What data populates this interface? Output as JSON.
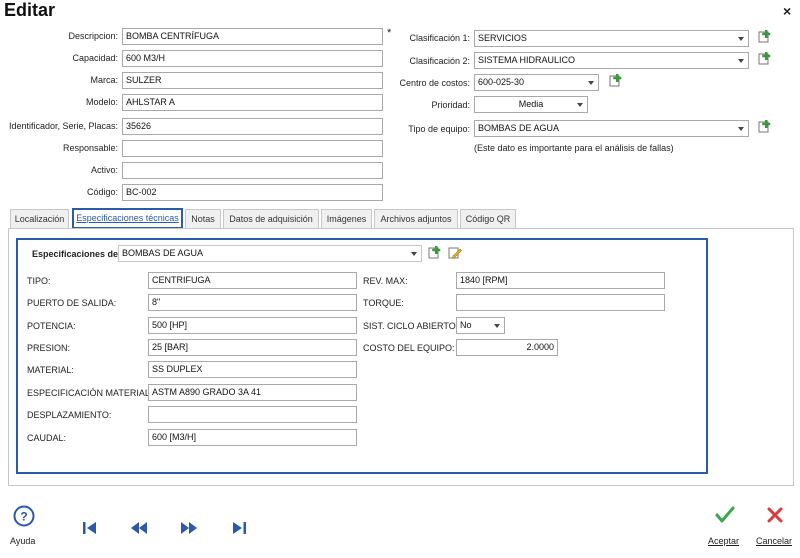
{
  "window": {
    "title": "Editar",
    "close_label": "×"
  },
  "form": {
    "descripcion": {
      "label": "Descripcion:",
      "value": "BOMBA CENTRÍFUGA",
      "required_mark": "*"
    },
    "capacidad": {
      "label": "Capacidad:",
      "value": "600 M3/H"
    },
    "marca": {
      "label": "Marca:",
      "value": "SULZER"
    },
    "modelo": {
      "label": "Modelo:",
      "value": "AHLSTAR A"
    },
    "identificador": {
      "label": "Identificador, Serie, Placas:",
      "value": "35626"
    },
    "responsable": {
      "label": "Responsable:",
      "value": ""
    },
    "activo": {
      "label": "Activo:",
      "value": ""
    },
    "codigo": {
      "label": "Código:",
      "value": "BC-002"
    }
  },
  "classification": {
    "clasificacion1": {
      "label": "Clasificación 1:",
      "value": "SERVICIOS"
    },
    "clasificacion2": {
      "label": "Clasificación 2:",
      "value": "SISTEMA HIDRAULICO"
    },
    "centro_costos": {
      "label": "Centro de costos:",
      "value": "600-025-30"
    },
    "prioridad": {
      "label": "Prioridad:",
      "value": "Media"
    },
    "tipo_equipo": {
      "label": "Tipo de equipo:",
      "value": "BOMBAS DE AGUA"
    },
    "note": "(Este dato es importante para el análisis de fallas)"
  },
  "tabs": [
    {
      "label": "Localización"
    },
    {
      "label": "Especificaciones técnicas"
    },
    {
      "label": "Notas"
    },
    {
      "label": "Datos de adquisición"
    },
    {
      "label": "Imágenes"
    },
    {
      "label": "Archivos adjuntos"
    },
    {
      "label": "Código QR"
    }
  ],
  "active_tab": "Especificaciones técnicas",
  "specs": {
    "header_label": "Especificaciones de:",
    "header_value": "BOMBAS DE AGUA",
    "left": [
      {
        "label": "TIPO:",
        "value": "CENTRIFUGA"
      },
      {
        "label": "PUERTO DE SALIDA:",
        "value": "8\""
      },
      {
        "label": "POTENCIA:",
        "value": "500 [HP]"
      },
      {
        "label": "PRESION:",
        "value": "25 [BAR]"
      },
      {
        "label": "MATERIAL:",
        "value": "SS DUPLEX"
      },
      {
        "label": "ESPECIFICACIÓN MATERIAL:",
        "value": "ASTM A890 GRADO 3A 41"
      },
      {
        "label": "DESPLAZAMIENTO:",
        "value": ""
      },
      {
        "label": "CAUDAL:",
        "value": "600 [M3/H]"
      }
    ],
    "right": [
      {
        "label": "REV. MAX:",
        "value": "1840 [RPM]"
      },
      {
        "label": "TORQUE:",
        "value": ""
      },
      {
        "label": "SIST. CICLO ABIERTO:",
        "value": "No"
      },
      {
        "label": "COSTO DEL EQUIPO:",
        "value": "2.0000"
      }
    ]
  },
  "footer": {
    "ayuda": "Ayuda",
    "aceptar": "Aceptar",
    "cancelar": "Cancelar"
  },
  "colors": {
    "accent": "#2a5aa8",
    "add_green": "#3a9a3a",
    "accept_green": "#3aa84a",
    "cancel_red": "#d93a3a",
    "edit_yellow": "#e8b820"
  }
}
